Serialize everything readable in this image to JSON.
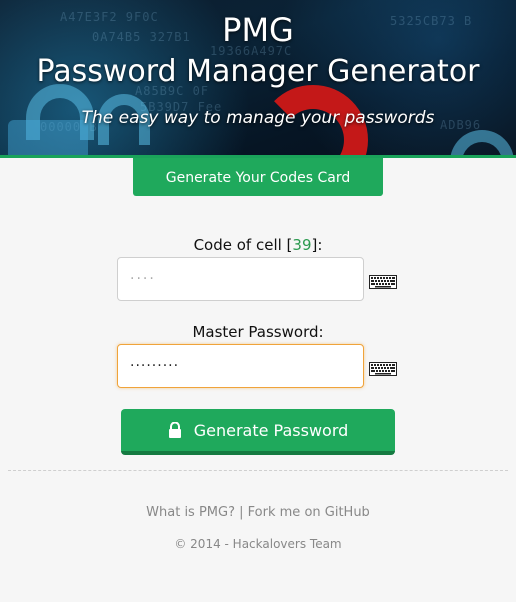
{
  "header": {
    "title": "PMG",
    "subtitle": "Password Manager Generator",
    "tagline": "The easy way to manage your passwords",
    "background_code": [
      "5325CB73 B",
      "A47E3F2 9F0C",
      "0A74B5 327B1",
      "19366A497C",
      "A85B9C 0F",
      "5B39D7 Fee",
      "ADB96",
      "00000 B"
    ]
  },
  "codes_card_button": {
    "label": "Generate Your Codes Card"
  },
  "code_cell": {
    "label_prefix": "Code of cell [",
    "cell_number": "39",
    "label_suffix": "]:",
    "placeholder": "····"
  },
  "master_password": {
    "label": "Master Password:",
    "value": "·········"
  },
  "generate_button": {
    "label": "Generate Password"
  },
  "footer": {
    "what_is_link": "What is PMG?",
    "separator": "|",
    "github_link": "Fork me on GitHub",
    "copyright": "© 2014 - Hackalovers Team"
  },
  "colors": {
    "accent_green": "#1fa95c",
    "focus_orange": "#f0a33a",
    "cell_number": "#2a9a4e"
  },
  "icons": [
    "keyboard-icon",
    "lock-icon"
  ]
}
